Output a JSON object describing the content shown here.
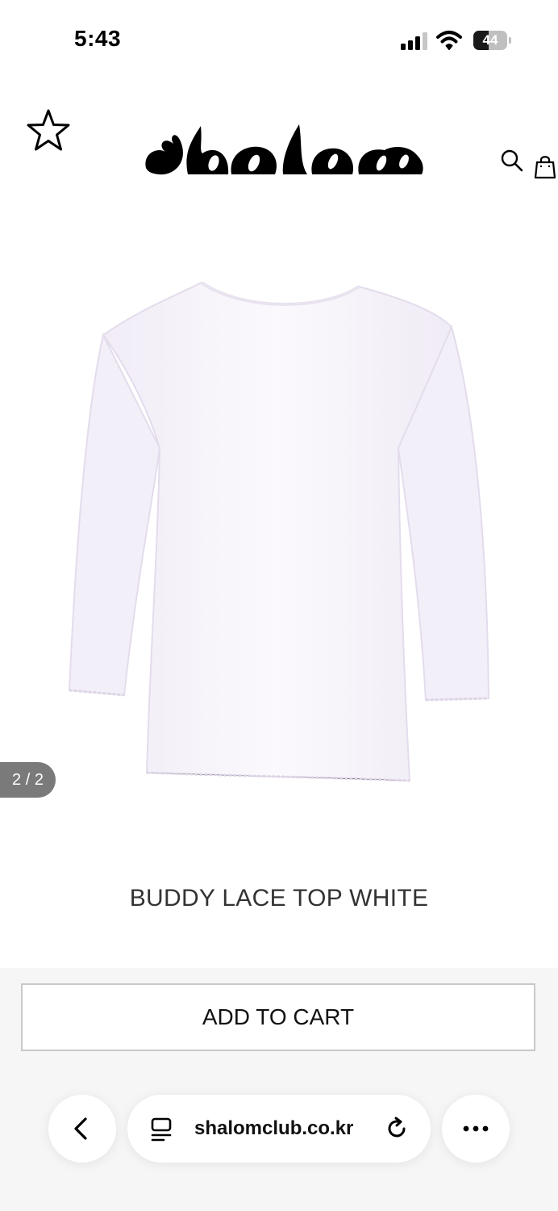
{
  "status_bar": {
    "time": "5:43",
    "battery": "44"
  },
  "header": {
    "logo": "shalom"
  },
  "product": {
    "image_counter": "2 / 2",
    "title": "BUDDY LACE TOP WHITE",
    "add_to_cart_label": "ADD TO CART"
  },
  "browser": {
    "url": "shalomclub.co.kr"
  },
  "icons": [
    "star-icon",
    "search-icon",
    "shopping-bag-icon",
    "back-chevron-icon",
    "page-icon",
    "reload-icon",
    "more-icon"
  ]
}
